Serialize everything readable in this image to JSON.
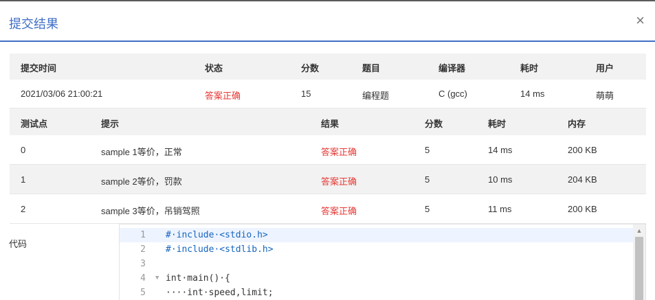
{
  "dialog": {
    "title": "提交结果",
    "close": "×"
  },
  "submission": {
    "headers": [
      "提交时间",
      "状态",
      "分数",
      "题目",
      "编译器",
      "耗时",
      "用户"
    ],
    "row": [
      "2021/03/06 21:00:21",
      "答案正确",
      "15",
      "编程题",
      "C (gcc)",
      "14 ms",
      "萌萌"
    ]
  },
  "tests": {
    "headers": [
      "测试点",
      "提示",
      "结果",
      "分数",
      "耗时",
      "内存"
    ],
    "rows": [
      [
        "0",
        "sample 1等价，正常",
        "答案正确",
        "5",
        "14 ms",
        "200 KB"
      ],
      [
        "1",
        "sample 2等价，罚款",
        "答案正确",
        "5",
        "10 ms",
        "204 KB"
      ],
      [
        "2",
        "sample 3等价，吊销驾照",
        "答案正确",
        "5",
        "11 ms",
        "200 KB"
      ]
    ]
  },
  "code": {
    "label": "代码",
    "lines": [
      {
        "n": "1",
        "pp": "#·include·",
        "rest": "<stdio.h>"
      },
      {
        "n": "2",
        "pp": "#·include·",
        "rest": "<stdlib.h>"
      },
      {
        "n": "3",
        "pp": "",
        "rest": ""
      },
      {
        "n": "4",
        "pp": "",
        "rest": "int·main()·{"
      },
      {
        "n": "5",
        "pp": "",
        "rest": "····int·speed,limit;"
      }
    ]
  },
  "colors": {
    "accent": "#3f6ec6",
    "accepted": "#e53935"
  }
}
